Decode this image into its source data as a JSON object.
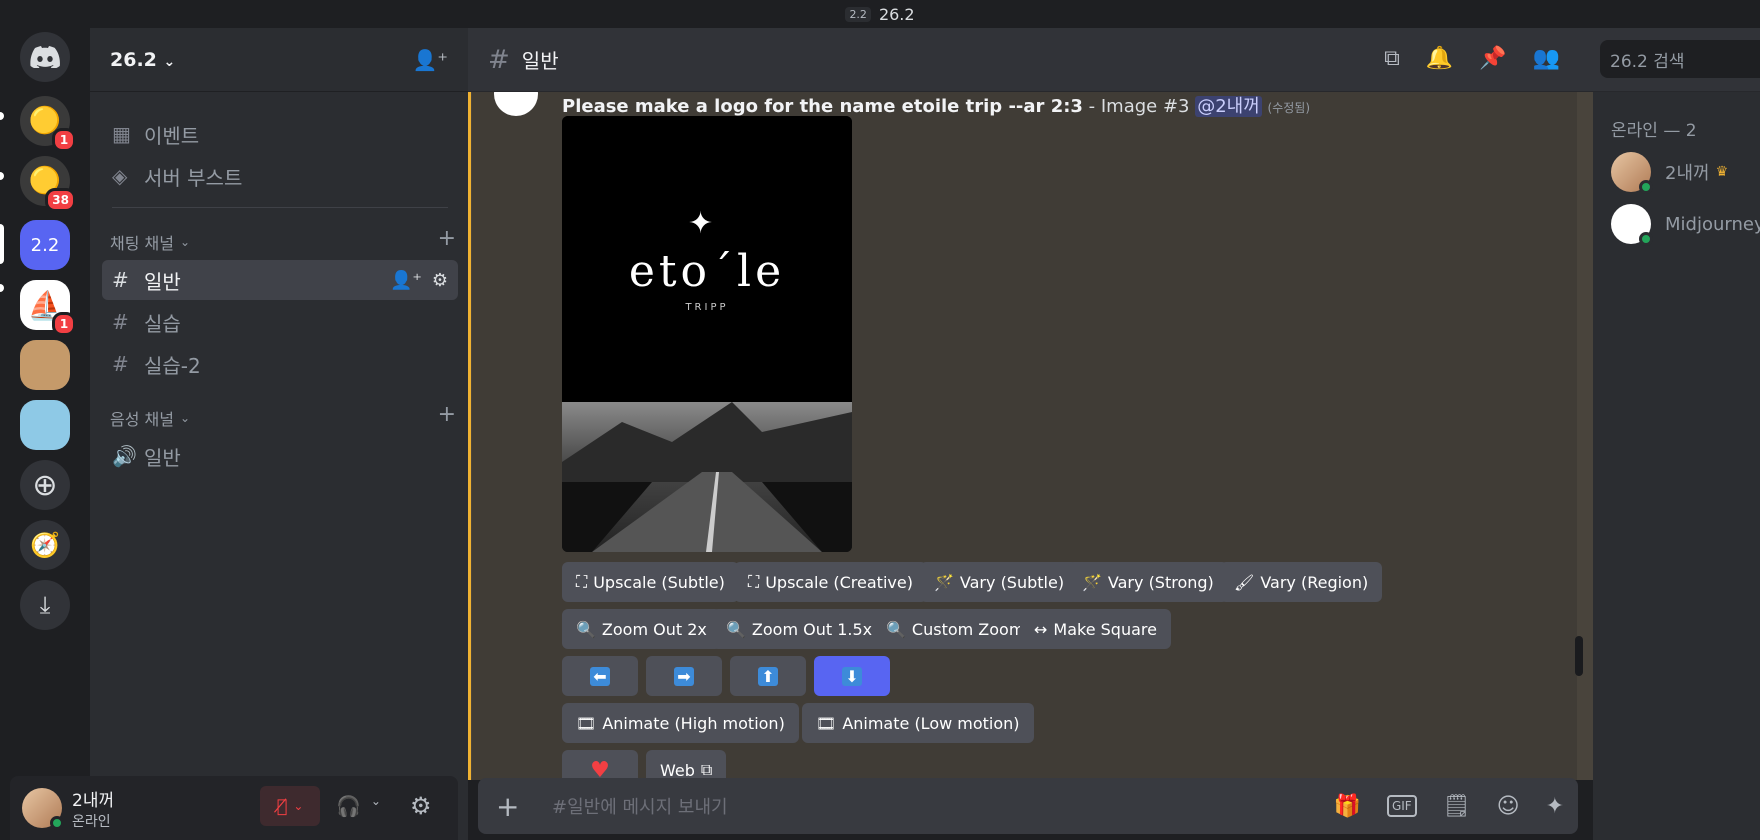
{
  "window": {
    "version_badge": "2.2",
    "title": "26.2"
  },
  "rail": {
    "servers": [
      {
        "name": "server-1",
        "badge": "1"
      },
      {
        "name": "server-2",
        "badge": "38"
      },
      {
        "name": "server-active",
        "label": "2.2"
      },
      {
        "name": "midjourney-server",
        "badge": "1"
      }
    ]
  },
  "sidebar": {
    "server_name": "26.2",
    "events": "이벤트",
    "boost": "서버 부스트",
    "text_category": "채팅 채널",
    "voice_category": "음성 채널",
    "text_channels": [
      "일반",
      "실습",
      "실습-2"
    ],
    "voice_channels": [
      "일반"
    ]
  },
  "user": {
    "name": "2내꺼",
    "status": "온라인"
  },
  "topbar": {
    "channel": "일반",
    "search_placeholder": "26.2 검색"
  },
  "message": {
    "prompt": "Please make a logo for the name etoile trip --ar 2:3",
    "suffix": " - Image #3 ",
    "mention": "@2내꺼",
    "edited": "(수정됨)",
    "image_brand": "etoˊle",
    "image_sub": "TRIPP",
    "buttons_row1": [
      "Upscale (Subtle)",
      "Upscale (Creative)",
      "Vary (Subtle)",
      "Vary (Strong)",
      "Vary (Region)"
    ],
    "buttons_row2": [
      "Zoom Out 2x",
      "Zoom Out 1.5x",
      "Custom Zoom",
      "Make Square"
    ],
    "buttons_row4": [
      "Animate (High motion)",
      "Animate (Low motion)"
    ],
    "web_label": "Web"
  },
  "members": {
    "header": "온라인 — 2",
    "list": [
      {
        "name": "2내꺼"
      },
      {
        "name": "Midjourney"
      }
    ]
  },
  "composer": {
    "placeholder": "#일반에 메시지 보내기",
    "gif": "GIF"
  }
}
